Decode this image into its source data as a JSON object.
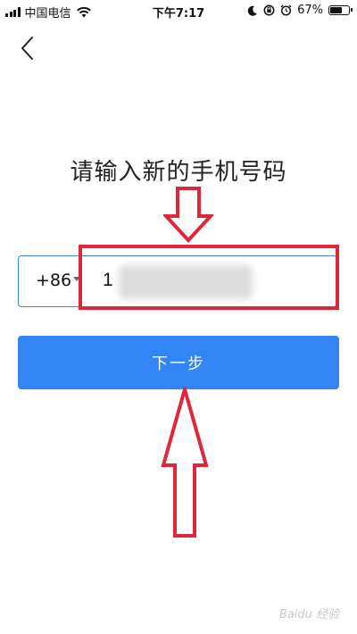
{
  "status_bar": {
    "carrier": "中国电信",
    "time": "下午7:17",
    "battery_percent": "67%",
    "battery_level": 0.67
  },
  "nav": {
    "back_icon": "chevron-left-icon"
  },
  "page": {
    "title": "请输入新的手机号码"
  },
  "phone_field": {
    "country_code": "+86",
    "value": "1"
  },
  "next_button": {
    "label": "下一步"
  },
  "annotations": {
    "highlight_color": "#e0263a",
    "arrow_color": "#e0263a"
  },
  "watermark": {
    "text": "Baidu 经验"
  },
  "colors": {
    "primary": "#3385f6",
    "input_border": "#3d85e8"
  }
}
